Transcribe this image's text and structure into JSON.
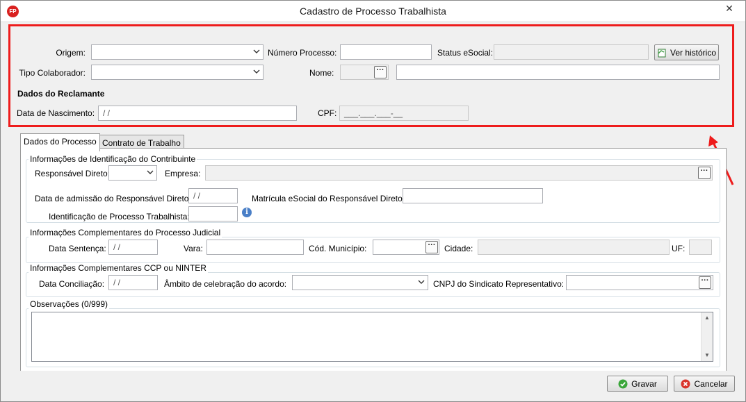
{
  "window": {
    "title": "Cadastro de Processo Trabalhista",
    "app_icon_text": "FP",
    "close_glyph": "✕"
  },
  "header": {
    "origem_label": "Origem:",
    "origem_value": "",
    "numero_processo_label": "Número Processo:",
    "numero_processo_value": "",
    "status_esocial_label": "Status eSocial:",
    "status_esocial_value": "",
    "ver_historico_label": "Ver histórico",
    "tipo_colaborador_label": "Tipo Colaborador:",
    "tipo_colaborador_value": "",
    "nome_label": "Nome:",
    "nome_code_value": "",
    "nome_value": "",
    "dados_reclamante_heading": "Dados do Reclamante",
    "data_nascimento_label": "Data de Nascimento:",
    "data_nascimento_value": " / /",
    "cpf_label": "CPF:",
    "cpf_value": "___.___.___-__"
  },
  "tabs": [
    {
      "label": "Dados do Processo",
      "active": true
    },
    {
      "label": "Contrato de Trabalho",
      "active": false
    }
  ],
  "contribuinte": {
    "group_title": "Informações de Identificação do Contribuinte",
    "responsavel_direto_label": "Responsável Direto:",
    "responsavel_direto_value": "",
    "empresa_label": "Empresa:",
    "empresa_value": "",
    "data_admissao_label": "Data de admissão do Responsável Direto:",
    "data_admissao_value": " / /",
    "matricula_label": "Matrícula eSocial do Responsável Direto",
    "matricula_value": "",
    "identificacao_label": "Identificação de Processo Trabalhista:",
    "identificacao_value": ""
  },
  "judicial": {
    "group_title": "Informações Complementares do Processo Judicial",
    "data_sentenca_label": "Data Sentença:",
    "data_sentenca_value": " / /",
    "vara_label": "Vara:",
    "vara_value": "",
    "cod_municipio_label": "Cód. Município:",
    "cod_municipio_value": "",
    "cidade_label": "Cidade:",
    "cidade_value": "",
    "uf_label": "UF:",
    "uf_value": ""
  },
  "ccp": {
    "group_title": "Informações Complementares CCP ou NINTER",
    "data_conciliacao_label": "Data Conciliação:",
    "data_conciliacao_value": " / /",
    "ambito_label": "Âmbito de celebração do acordo:",
    "ambito_value": "",
    "cnpj_label": "CNPJ do Sindicato Representativo:",
    "cnpj_value": ""
  },
  "observacoes": {
    "group_title": "Observações (0/999)",
    "value": ""
  },
  "footer": {
    "gravar_label": "Gravar",
    "gravar_accel": "G",
    "cancelar_label": "Cancelar",
    "cancelar_accel": "C"
  },
  "colors": {
    "highlight": "#ee1c1c",
    "gravar_icon": "#3aa63a",
    "cancelar_icon": "#d9342b"
  }
}
